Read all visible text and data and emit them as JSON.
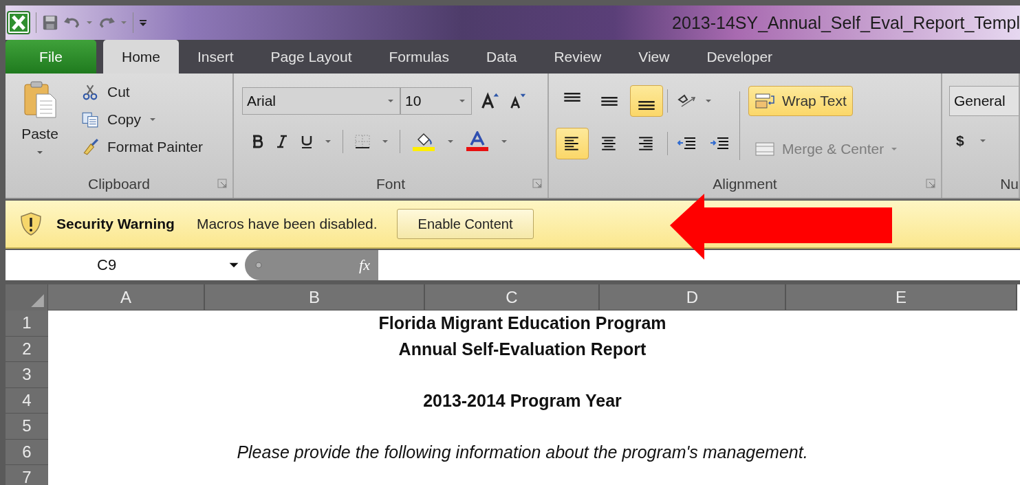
{
  "title_bar": {
    "title": "2013-14SY_Annual_Self_Eval_Report_Templ"
  },
  "tabs": [
    {
      "label": "File",
      "kind": "file",
      "selected": false
    },
    {
      "label": "Home",
      "kind": "tab",
      "selected": true
    },
    {
      "label": "Insert",
      "kind": "tab",
      "selected": false
    },
    {
      "label": "Page Layout",
      "kind": "tab",
      "selected": false
    },
    {
      "label": "Formulas",
      "kind": "tab",
      "selected": false
    },
    {
      "label": "Data",
      "kind": "tab",
      "selected": false
    },
    {
      "label": "Review",
      "kind": "tab",
      "selected": false
    },
    {
      "label": "View",
      "kind": "tab",
      "selected": false
    },
    {
      "label": "Developer",
      "kind": "tab",
      "selected": false
    }
  ],
  "ribbon": {
    "clipboard": {
      "group": "Clipboard",
      "paste": "Paste",
      "cut": "Cut",
      "copy": "Copy",
      "format_painter": "Format Painter"
    },
    "font": {
      "group": "Font",
      "name": "Arial",
      "size": "10"
    },
    "alignment": {
      "group": "Alignment",
      "vertical": [
        {
          "kind": "top",
          "selected": false
        },
        {
          "kind": "middle",
          "selected": false
        },
        {
          "kind": "bottom",
          "selected": true
        }
      ],
      "horizontal": [
        {
          "kind": "left",
          "selected": true
        },
        {
          "kind": "center",
          "selected": false
        },
        {
          "kind": "right",
          "selected": false
        }
      ],
      "wrap_text": {
        "label": "Wrap Text",
        "selected": true
      },
      "merge": {
        "label": "Merge & Center",
        "disabled": true
      }
    },
    "number": {
      "group": "Nu",
      "format": "General",
      "currency": "$"
    }
  },
  "security_bar": {
    "title": "Security Warning",
    "message": "Macros have been disabled.",
    "button": "Enable Content"
  },
  "formula_bar": {
    "name_box": "C9",
    "fx": "fx"
  },
  "sheet": {
    "columns": [
      "A",
      "B",
      "C",
      "D",
      "E"
    ],
    "rows": [
      {
        "number": "1",
        "text": "Florida Migrant Education Program",
        "kind": "heading"
      },
      {
        "number": "2",
        "text": "Annual Self-Evaluation Report",
        "kind": "heading"
      },
      {
        "number": "3"
      },
      {
        "number": "4",
        "text": "2013-2014 Program Year",
        "kind": "heading"
      },
      {
        "number": "5"
      },
      {
        "number": "6",
        "text": "Please provide the following information about the program's management.",
        "kind": "note"
      },
      {
        "number": "7"
      }
    ]
  }
}
